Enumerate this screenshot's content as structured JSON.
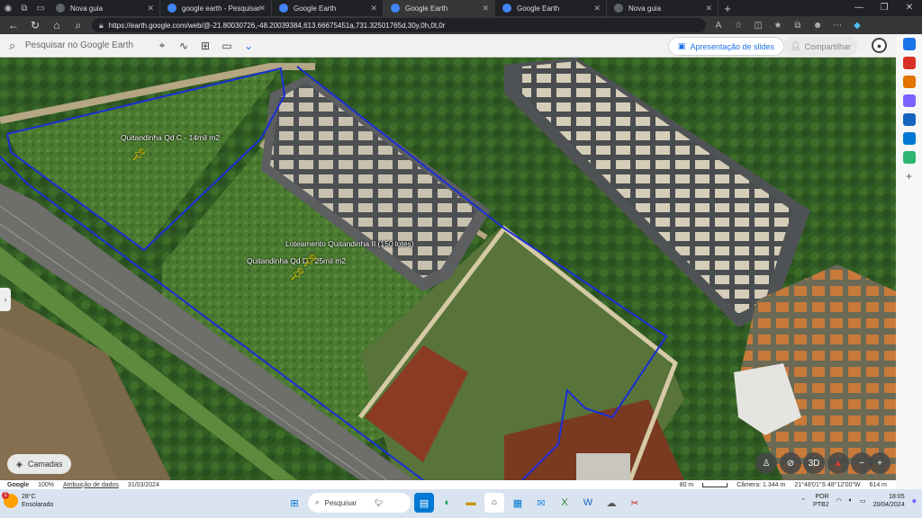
{
  "browser": {
    "tabs": [
      {
        "title": "Nova guia",
        "color": "#5f6368",
        "active": false
      },
      {
        "title": "google earth - Pesquisar",
        "color": "#4285f4",
        "active": false
      },
      {
        "title": "Google Earth",
        "color": "#4285f4",
        "active": false
      },
      {
        "title": "Google Earth",
        "color": "#4285f4",
        "active": true
      },
      {
        "title": "Google Earth",
        "color": "#4285f4",
        "active": false
      },
      {
        "title": "Nova guia",
        "color": "#5f6368",
        "active": false
      }
    ],
    "url": "https://earth.google.com/web/@-21.80030726,-48.20039384,613.66675451a,731.32501765d,30y,0h,0t,0r"
  },
  "earth": {
    "search_placeholder": "Pesquisar no Google Earth",
    "slides_button": "Apresentação de slides",
    "share_button": "Compartilhar",
    "layers_button": "Camadas",
    "labels": {
      "quadra_c": "Quitandinha Qd C - 14mil m2",
      "loteamento": "Loteamento Quitandinha II (150 lotes)",
      "quadra_d": "Quitandinha Qd D - 25mil m2"
    },
    "controls": {
      "view_3d": "3D",
      "zoom_out": "−",
      "zoom_in": "+"
    }
  },
  "statusbar": {
    "brand": "Google",
    "loaded": "100%",
    "attribution": "Atribuição de dados",
    "date": "31/03/2024",
    "scale": "80 m",
    "camera": "Câmera: 1.344 m",
    "coords": "21°48'01\"S 48°12'00\"W",
    "altitude": "614 m"
  },
  "taskbar": {
    "weather_temp": "28°C",
    "weather_desc": "Ensolarado",
    "weather_badge": "1",
    "search_label": "Pesquisar",
    "lang": "POR",
    "layout": "PTB2",
    "time": "18:05",
    "date": "20/04/2024"
  }
}
